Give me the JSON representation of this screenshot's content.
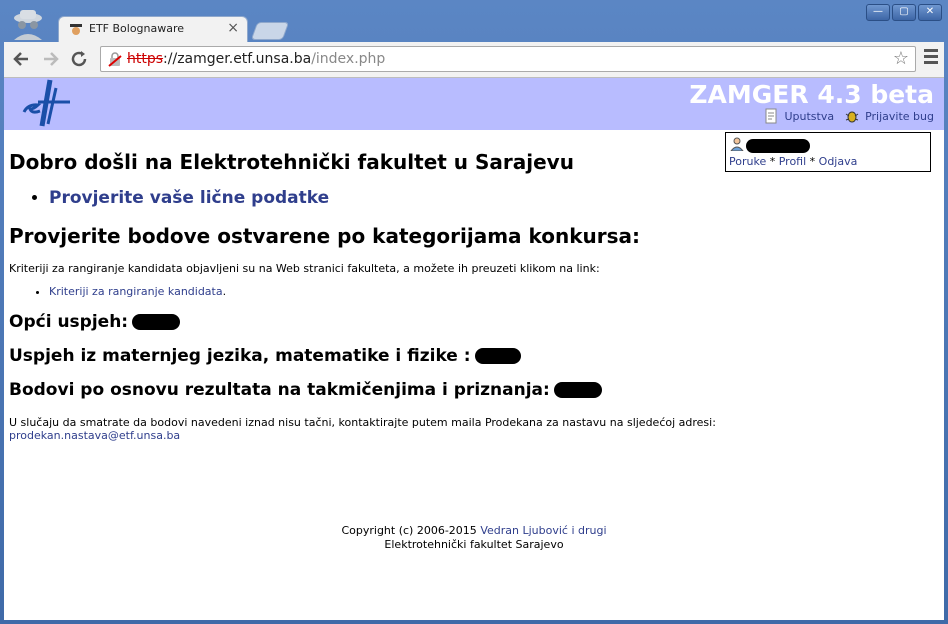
{
  "browser": {
    "tab_title": "ETF Bolognaware",
    "tab_close": "×",
    "url_scheme": "https",
    "url_sep": "://",
    "url_host": "zamger.etf.unsa.ba",
    "url_path": "/index.php",
    "window_buttons": [
      "—",
      "▢",
      "✕"
    ]
  },
  "header": {
    "app_title": "ZAMGER 4.3 beta",
    "help_label": "Uputstva",
    "bug_label": "Prijavite bug"
  },
  "userbox": {
    "messages_label": "Poruke",
    "profile_label": "Profil",
    "logout_label": "Odjava",
    "separator": "*"
  },
  "main": {
    "welcome_title": "Dobro došli na Elektrotehnički fakultet u Sarajevu",
    "check_data_link": "Provjerite vaše lične podatke",
    "section_title": "Provjerite bodove ostvarene po kategorijama konkursa:",
    "criteria_text": "Kriteriji za rangiranje kandidata objavljeni su na Web stranici fakulteta, a možete ih preuzeti klikom na link:",
    "criteria_link": "Kriteriji za rangiranje kandidata",
    "criteria_period": ".",
    "general_success_label": "Opći uspjeh:",
    "subjects_label": "Uspjeh iz maternjeg jezika, matematike i fizike :",
    "competitions_label": "Bodovi po osnovu rezultata na takmičenjima i priznanja:",
    "contact_text": "U slučaju da smatrate da bodovi navedeni iznad nisu tačni, kontaktirajte putem maila Prodekana za nastavu na sljedećoj adresi:",
    "contact_email": "prodekan.nastava@etf.unsa.ba"
  },
  "footer": {
    "copyright": "Copyright (c) 2006-2015",
    "authors_link": "Vedran Ljubović i drugi",
    "institution": "Elektrotehnički fakultet Sarajevo"
  },
  "colors": {
    "banner": "#b8bcff",
    "link": "#2f3e8c",
    "logo": "#1a4fa8"
  }
}
